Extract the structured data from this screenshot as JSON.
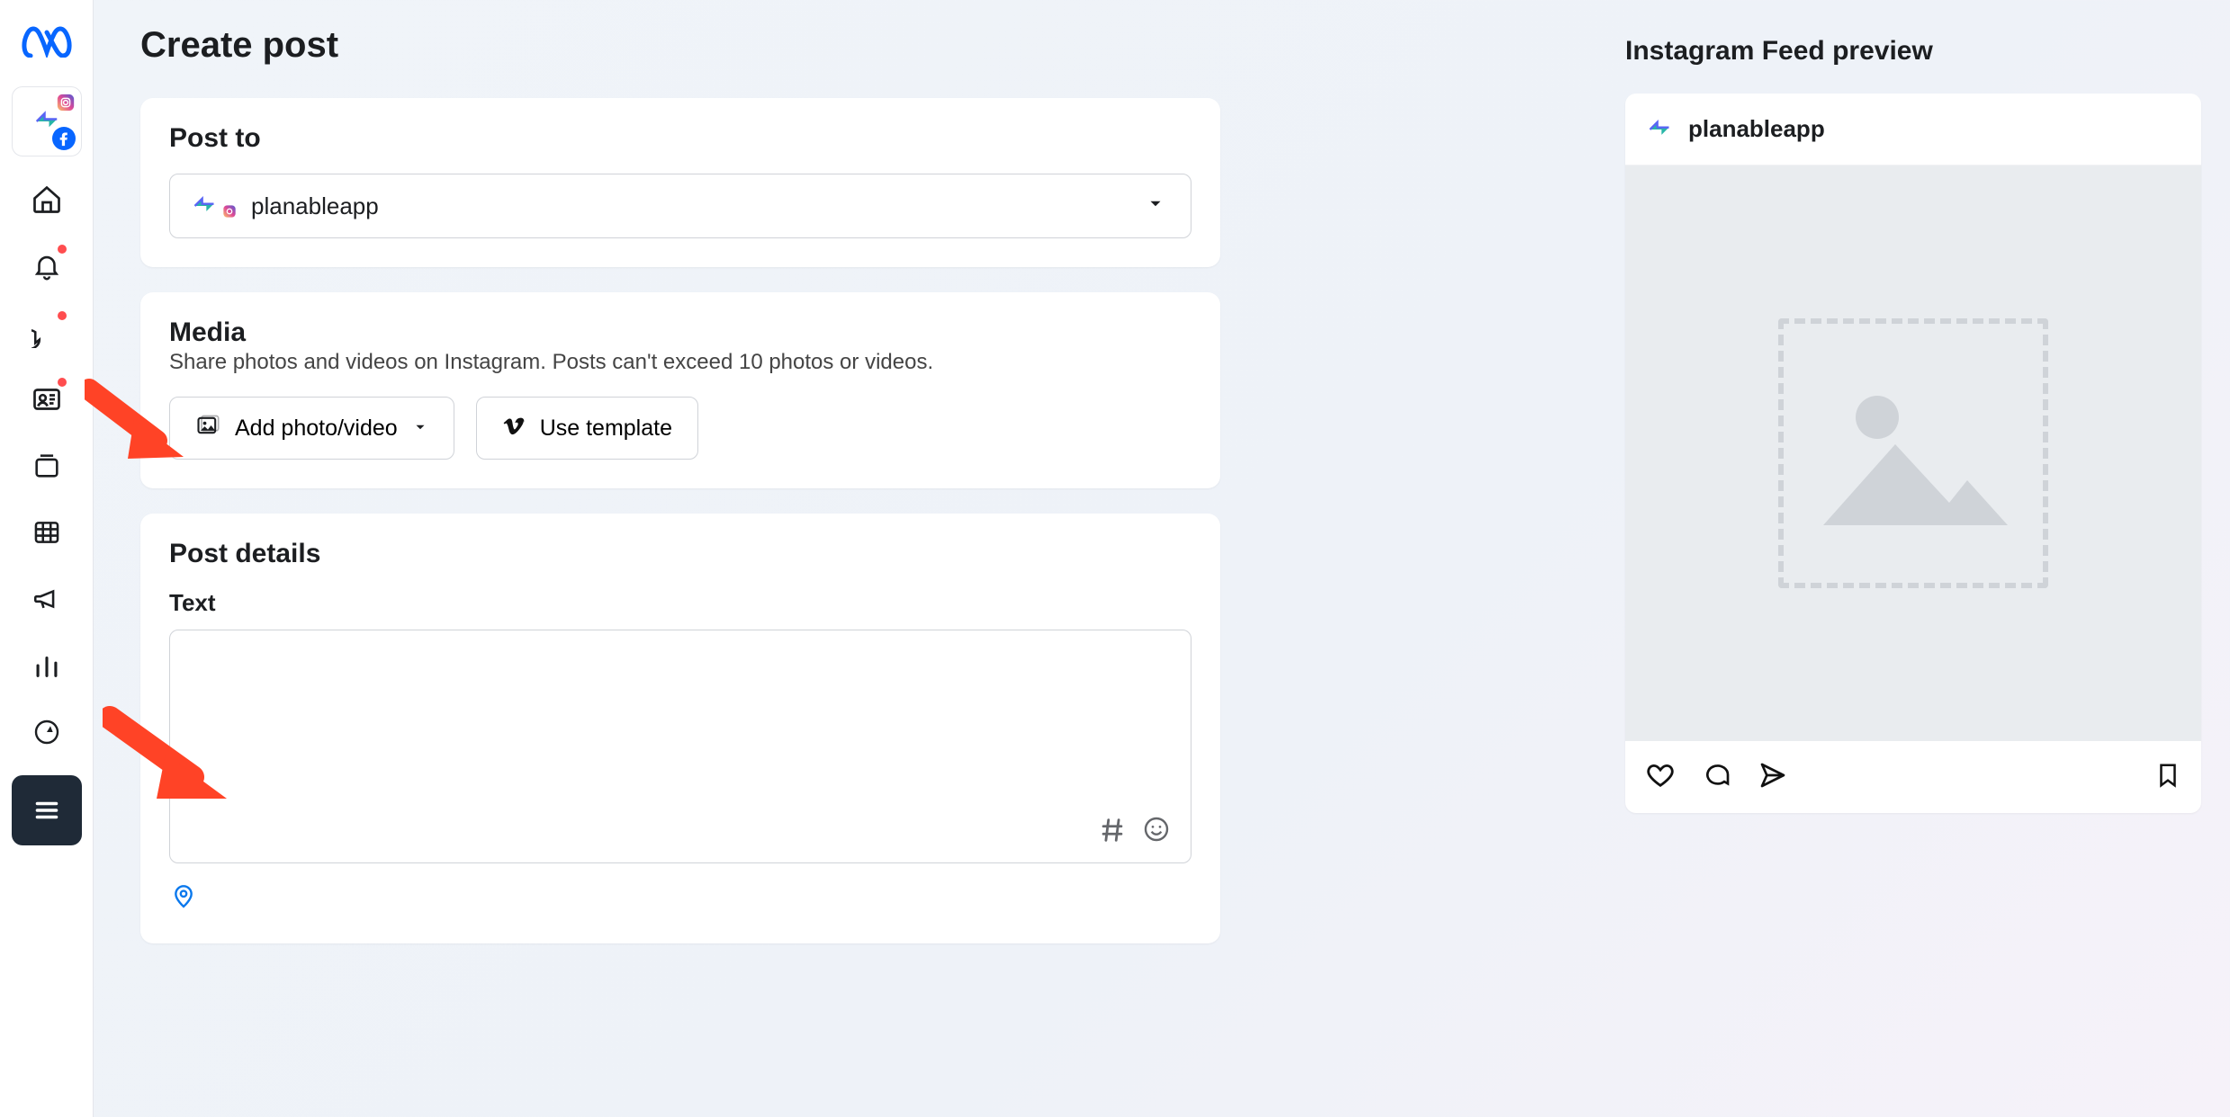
{
  "page": {
    "title": "Create post"
  },
  "sections": {
    "post_to": {
      "title": "Post to",
      "account_name": "planableapp"
    },
    "media": {
      "title": "Media",
      "subtitle": "Share photos and videos on Instagram. Posts can't exceed 10 photos or videos.",
      "add_button": "Add photo/video",
      "template_button": "Use template"
    },
    "details": {
      "title": "Post details",
      "text_label": "Text",
      "text_value": "",
      "text_placeholder": ""
    }
  },
  "preview": {
    "title": "Instagram Feed preview",
    "account_name": "planableapp"
  },
  "icons": {
    "meta": "meta-logo",
    "home": "home",
    "bell": "notifications",
    "chat": "messages",
    "contact": "id-card",
    "panel": "content",
    "grid": "calendar",
    "mega": "announcements",
    "bar": "insights",
    "plan": "planner",
    "menu": "menu"
  },
  "colors": {
    "brand": "#0a78ed",
    "arrow": "#ff4326"
  }
}
